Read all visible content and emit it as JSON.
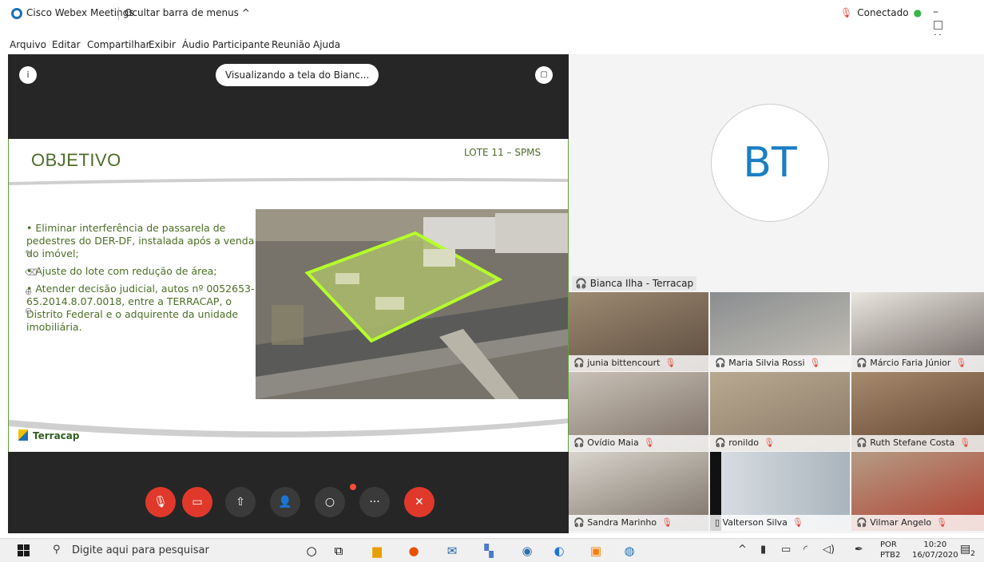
{
  "titlebar": {
    "app_title": "Cisco Webex Meetings",
    "hide_menu": "Ocultar barra de menus ^",
    "status": "Conectado",
    "window_controls": "– □ ×"
  },
  "menubar": {
    "items": [
      "Arquivo",
      "Editar",
      "Compartilhar",
      "Exibir",
      "Áudio",
      "Participante",
      "Reunião",
      "Ajuda"
    ]
  },
  "share": {
    "info_icon": "i",
    "viewing_label": "Visualizando a tela do Bianc...",
    "layout_icon": "▢"
  },
  "slide": {
    "title": "OBJETIVO",
    "lote": "LOTE 11 – SPMS",
    "bullets": [
      "• Eliminar interferência de passarela de pedestres do DER-DF, instalada após a venda do imóvel;",
      "• Ajuste do lote com redução de área;",
      "• Atender decisão judicial, autos nº 0052653-65.2014.8.07.0018, entre a TERRACAP, o Distrito Federal e o adquirente da unidade imobiliária."
    ],
    "logo_text": "Terracap"
  },
  "controls": {
    "mute": "mic-off-icon",
    "video": "video-off-icon",
    "share": "share-icon",
    "participants": "participants-icon",
    "chat": "chat-icon",
    "more": "more-icon",
    "leave": "leave-icon"
  },
  "active_speaker": {
    "initials": "BT",
    "name": "Bianca Ilha - Terracap"
  },
  "participants": [
    {
      "name": "junia bittencourt",
      "muted": true
    },
    {
      "name": "Maria Silvia Rossi",
      "muted": true
    },
    {
      "name": "Márcio Faria Júnior",
      "muted": true
    },
    {
      "name": "Ovídio Maia",
      "muted": true
    },
    {
      "name": "ronildo",
      "muted": true
    },
    {
      "name": "Ruth Stefane Costa",
      "muted": true
    },
    {
      "name": "Sandra Marinho",
      "muted": true
    },
    {
      "name": "Valterson Silva",
      "muted": true
    },
    {
      "name": "Vilmar Angelo",
      "muted": true
    }
  ],
  "taskbar": {
    "search_placeholder": "Digite aqui para pesquisar",
    "lang_top": "POR",
    "lang_bottom": "PTB2",
    "time": "10:20",
    "date": "16/07/2020",
    "notifications": "2"
  },
  "colors": {
    "accent": "#1b6fb8",
    "red": "#e0392b",
    "slide_green": "#4d6b2a"
  }
}
